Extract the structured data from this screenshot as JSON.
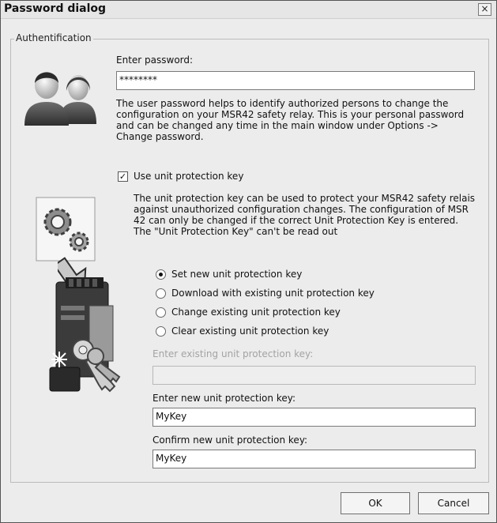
{
  "window": {
    "title": "Password dialog",
    "close_glyph": "×"
  },
  "auth": {
    "group_label": "Authentification",
    "password_label": "Enter password:",
    "password_value": "********",
    "password_help": "The user password helps to identify authorized persons to change the configuration on your MSR42 safety relay. This is your personal password and can be changed any time in the main window under Options -> Change password."
  },
  "protection": {
    "checkbox_label": "Use unit protection key",
    "checkbox_checked": true,
    "description": "The unit protection key can be used to protect your MSR42 safety relais against unauthorized configuration changes. The configuration of MSR 42 can only be changed if the correct Unit Protection Key is entered. The \"Unit Protection Key\" can't be read out",
    "options": [
      {
        "label": "Set new unit protection key",
        "selected": true
      },
      {
        "label": "Download with existing unit protection key",
        "selected": false
      },
      {
        "label": "Change existing unit protection key",
        "selected": false
      },
      {
        "label": "Clear existing unit protection key",
        "selected": false
      }
    ],
    "existing_key_label": "Enter existing unit protection key:",
    "existing_key_value": "",
    "new_key_label": "Enter new unit protection key:",
    "new_key_value": "MyKey",
    "confirm_key_label": "Confirm new unit protection key:",
    "confirm_key_value": "MyKey"
  },
  "buttons": {
    "ok": "OK",
    "cancel": "Cancel"
  },
  "icons": [
    "users-icon",
    "gears-icon",
    "arrow-icon",
    "safety-relay-icon",
    "keys-icon"
  ]
}
